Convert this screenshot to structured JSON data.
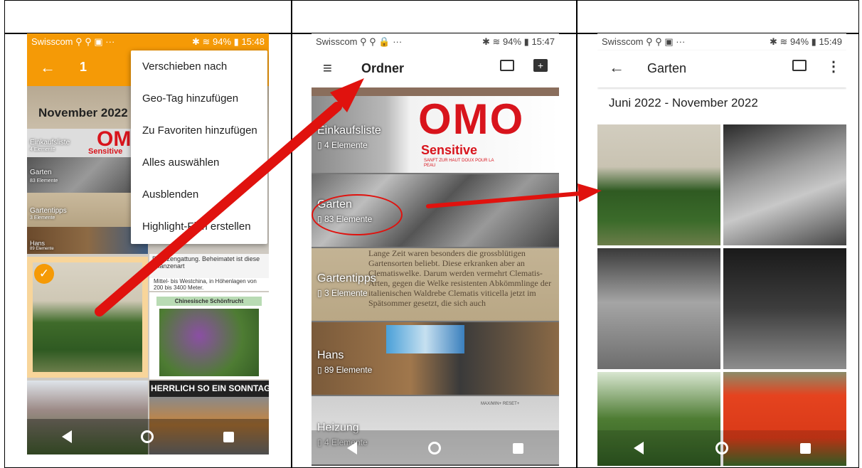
{
  "colors": {
    "orange": "#f59a06",
    "arrow": "#e0120e",
    "dark": "#2b2b2b"
  },
  "panel1": {
    "statusbar": {
      "carrier": "Swisscom",
      "battery": "94%",
      "time": "15:48"
    },
    "header": {
      "count": "1"
    },
    "menu": [
      "Verschieben nach",
      "Geo-Tag hinzufügen",
      "Zu Favoriten hinzufügen",
      "Alles auswählen",
      "Ausblenden",
      "Highlight-Film erstellen"
    ],
    "section": "November 2022",
    "mini": [
      {
        "name": "Einkaufsliste",
        "count": "4 Elemente"
      },
      {
        "name": "Garten",
        "count": "83 Elemente"
      },
      {
        "name": "Gartentipps",
        "count": "3 Elemente"
      },
      {
        "name": "Hans",
        "count": "89 Elemente"
      }
    ],
    "omo": "OMO",
    "omo_sub": "Sensitive",
    "doc_text1": "Chinesische Schönfrucht",
    "doc_text2": "Mittel- bis Westchina, in Höhenlagen von 200 bis 3400 Meter.",
    "doc_text3": "Pflanzengattung. Beheimatet ist diese Pflanzenart",
    "sunday": "HERRLICH SO EIN SONNTAG"
  },
  "panel2": {
    "statusbar": {
      "carrier": "Swisscom",
      "battery": "94%",
      "time": "15:47"
    },
    "header": {
      "title": "Ordner"
    },
    "folders": [
      {
        "name": "Einkaufsliste",
        "count": "4 Elemente"
      },
      {
        "name": "Garten",
        "count": "83 Elemente"
      },
      {
        "name": "Gartentipps",
        "count": "3 Elemente"
      },
      {
        "name": "Hans",
        "count": "89 Elemente"
      },
      {
        "name": "Heizung",
        "count": "4 Elemente"
      }
    ],
    "omo": "OMO",
    "omo_sub": "Sensitive",
    "omo_small": "SANFT ZUR HAUT DOUX POUR LA PEAU",
    "book_text": "Lange Zeit waren besonders die grossblütigen Gartensorten beliebt. Diese erkranken aber an Clematiswelke. Darum werden vermehrt Clematis-Arten, gegen die Welke resistenten Abkömmlinge der italienischen Waldrebe Clematis viticella jetzt im Spätsommer gesetzt, die sich auch",
    "heater": "MAX/MIN+  RESET+"
  },
  "panel3": {
    "statusbar": {
      "carrier": "Swisscom",
      "battery": "94%",
      "time": "15:49"
    },
    "header": {
      "title": "Garten"
    },
    "date_range": "Juni 2022 - November 2022"
  }
}
